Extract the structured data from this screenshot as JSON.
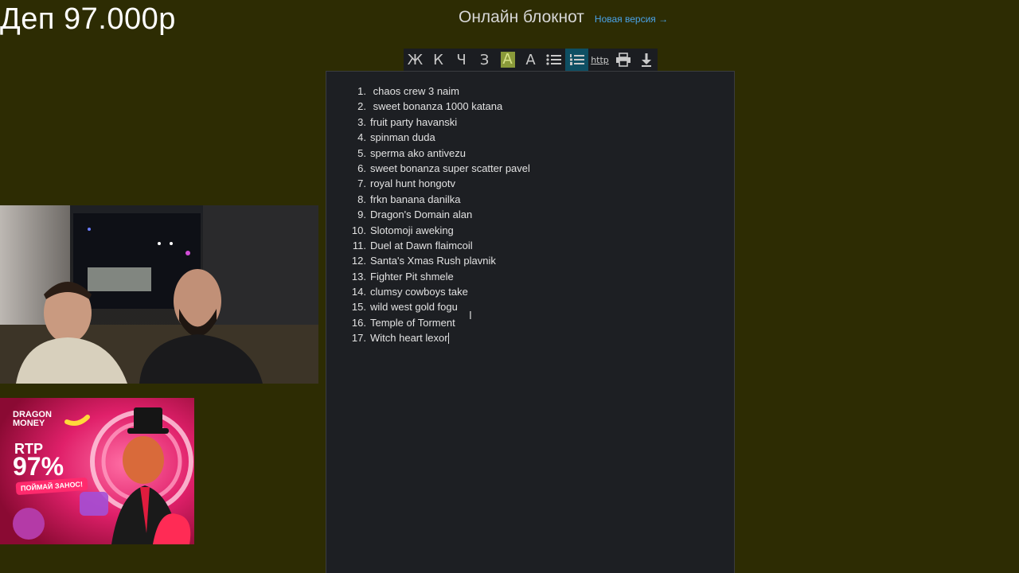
{
  "overlay": {
    "deposit_text": "Деп 97.000р"
  },
  "header": {
    "title": "Онлайн блокнот",
    "new_version_link": "Новая версия →"
  },
  "toolbar": {
    "buttons": [
      {
        "label": "Ж",
        "icon": "bold-icon"
      },
      {
        "label": "К",
        "icon": "italic-icon"
      },
      {
        "label": "Ч",
        "icon": "underline-icon"
      },
      {
        "label": "З",
        "icon": "strikethrough-icon"
      },
      {
        "label": "A",
        "icon": "highlight-icon"
      },
      {
        "label": "A",
        "icon": "text-color-icon"
      },
      {
        "label": "",
        "icon": "bullet-list-icon"
      },
      {
        "label": "",
        "icon": "numbered-list-icon",
        "active": true
      },
      {
        "label": "http",
        "icon": "link-icon"
      },
      {
        "label": "",
        "icon": "print-icon"
      },
      {
        "label": "",
        "icon": "download-icon"
      }
    ],
    "active_color": "#0e4f63",
    "highlight_color": "#8a9a3a"
  },
  "editor": {
    "items": [
      {
        "num": "1.",
        "text": " chaos crew 3 naim"
      },
      {
        "num": "2.",
        "text": " sweet bonanza 1000 katana"
      },
      {
        "num": "3.",
        "text": "fruit party havanski"
      },
      {
        "num": "4.",
        "text": "spinman duda"
      },
      {
        "num": "5.",
        "text": "sperma ako antivezu"
      },
      {
        "num": "6.",
        "text": "sweet bonanza super scatter pavel"
      },
      {
        "num": "7.",
        "text": "royal hunt hongotv"
      },
      {
        "num": "8.",
        "text": "frkn banana danilka"
      },
      {
        "num": "9.",
        "text": "Dragon's Domain alan"
      },
      {
        "num": "10.",
        "text": "Slotomoji aweking"
      },
      {
        "num": "11.",
        "text": "Duel at Dawn flaimcoil"
      },
      {
        "num": "12.",
        "text": "Santa's Xmas Rush plavnik"
      },
      {
        "num": "13.",
        "text": "Fighter Pit shmele"
      },
      {
        "num": "14.",
        "text": "clumsy cowboys take"
      },
      {
        "num": "15.",
        "text": "wild west gold fogu"
      },
      {
        "num": "16.",
        "text": "Temple of Torment"
      },
      {
        "num": "17.",
        "text": "Witch heart lexor"
      }
    ]
  },
  "promo": {
    "brand": "DRAGON MONEY",
    "rtp_label": "RTP",
    "rtp_value": "97%",
    "cta": "ПОЙМАЙ ЗАНОС!"
  },
  "colors": {
    "background": "#2d2c03",
    "editor_bg": "#1d1f23",
    "link": "#4aa3e8"
  }
}
